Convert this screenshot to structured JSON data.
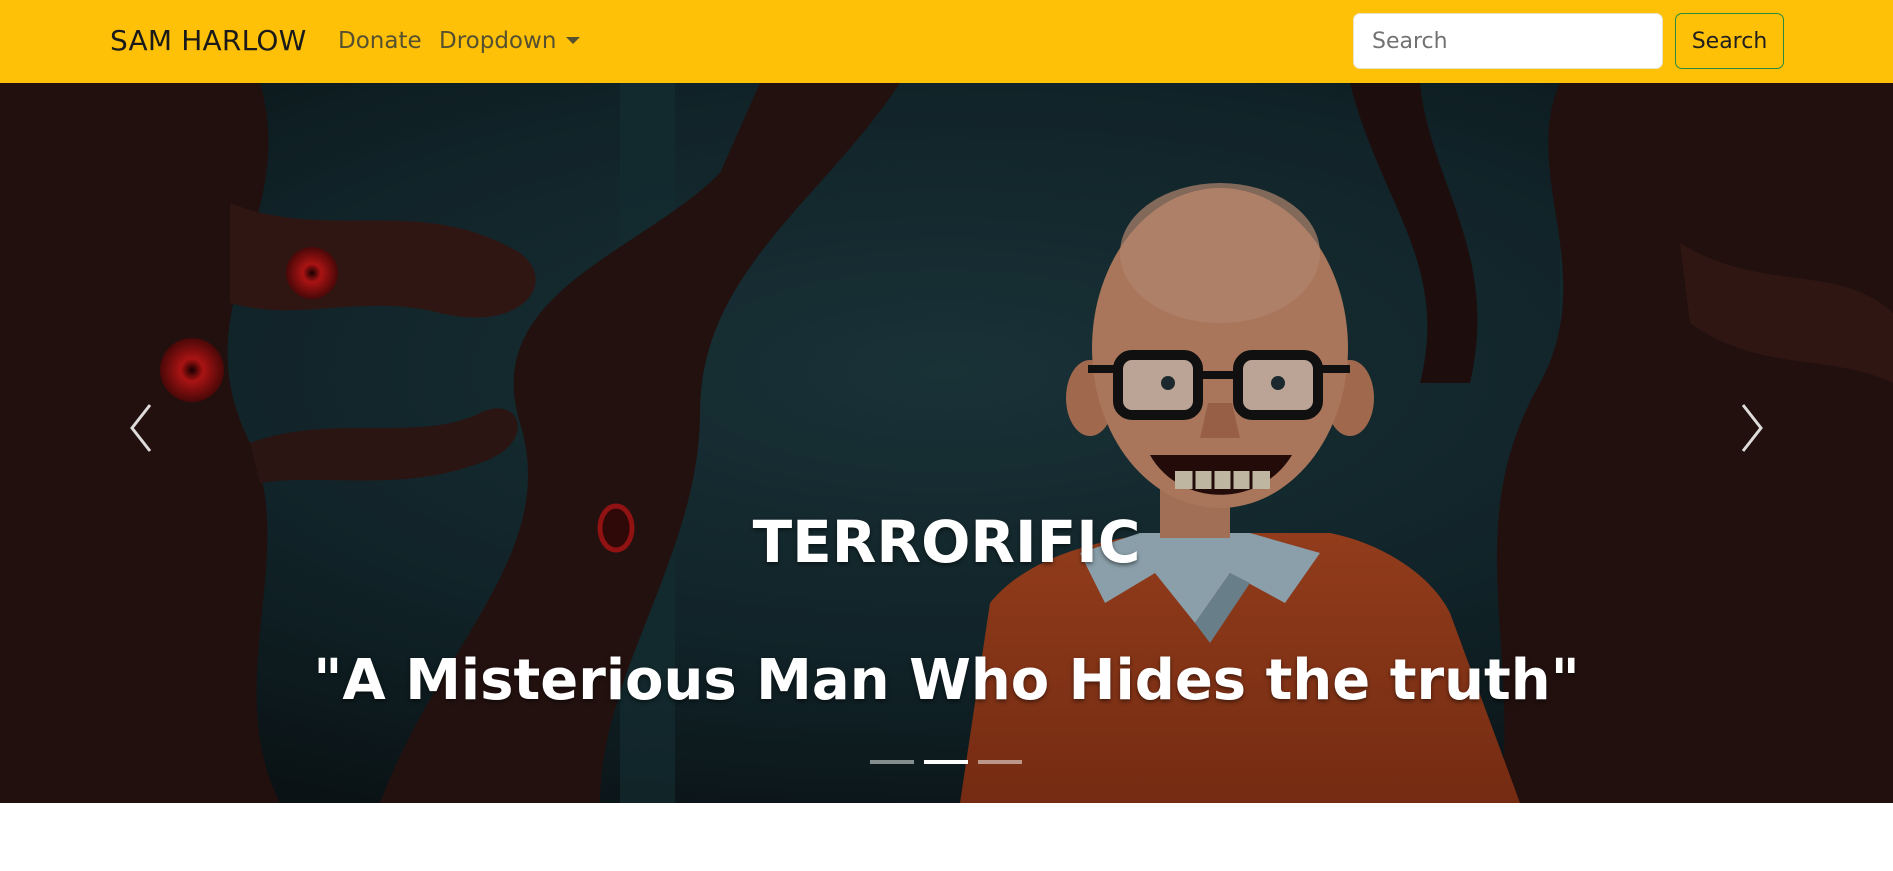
{
  "navbar": {
    "brand": "SAM HARLOW",
    "links": [
      {
        "label": "Donate"
      },
      {
        "label": "Dropdown",
        "icon": "caret-down-icon"
      }
    ],
    "search": {
      "placeholder": "Search",
      "button_label": "Search"
    },
    "colors": {
      "background": "#ffc107",
      "button_border": "#2a8a3d"
    }
  },
  "carousel": {
    "slide": {
      "title": "TERRORIFIC",
      "subtitle": "\"A Misterious Man Who Hides the truth\""
    },
    "controls": {
      "prev_icon": "chevron-left-icon",
      "next_icon": "chevron-right-icon"
    },
    "indicators": {
      "count": 3,
      "active": 2
    }
  }
}
